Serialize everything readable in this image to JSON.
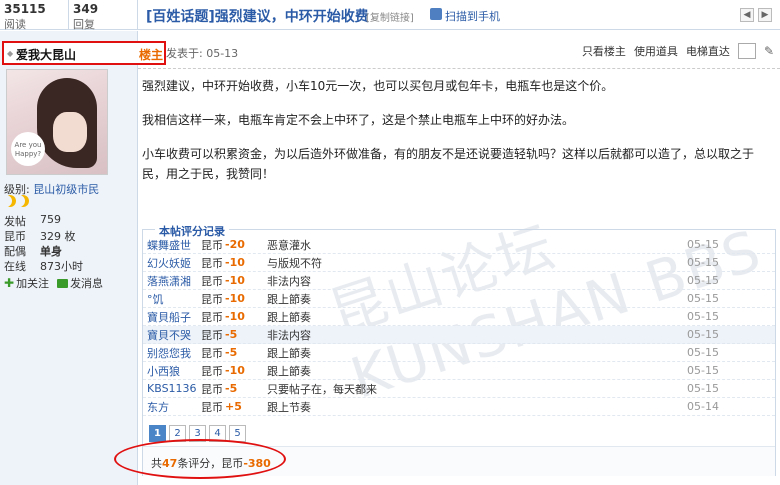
{
  "stats": [
    {
      "num": "35115",
      "label": "阅读"
    },
    {
      "num": "349",
      "label": "回复"
    }
  ],
  "thread": {
    "title": "[百姓话题]强烈建议，中环开始收费",
    "copy_link": "[复制链接]",
    "qr_text": "扫描到手机",
    "nav_prev": "◀",
    "nav_next": "▶"
  },
  "user": {
    "name": "爱我大昆山",
    "role": "楼主",
    "level_label": "级别:",
    "level_value": "昆山初级市民",
    "avatar_text": "Are you Happy?",
    "info": [
      {
        "k": "发帖",
        "v": "759"
      },
      {
        "k": "昆币",
        "v": "329 枚"
      },
      {
        "k": "配偶",
        "v": "单身"
      },
      {
        "k": "在线",
        "v": "873小时"
      }
    ],
    "follow_label": "加关注",
    "message_label": "发消息"
  },
  "post": {
    "date": "发表于: 05-13",
    "tools": [
      "只看楼主",
      "使用道具",
      "电梯直达"
    ],
    "paragraphs": [
      "强烈建议，中环开始收费，小车10元一次，也可以买包月或包年卡，电瓶车也是这个价。",
      "我相信这样一来，电瓶车肯定不会上中环了，这是个禁止电瓶车上中环的好办法。",
      "小车收费可以积累资金，为以后造外环做准备，有的朋友不是还说要造轻轨吗？这样以后就都可以造了，总以取之于民，用之于民，我赞同！"
    ]
  },
  "rating": {
    "title": "本帖评分记录",
    "rows": [
      {
        "user": "蝶舞盛世",
        "type": "昆币",
        "score": "-20",
        "reason": "恶意灌水",
        "date": "05-15"
      },
      {
        "user": "幻火妖姬",
        "type": "昆币",
        "score": "-10",
        "reason": "与版规不符",
        "date": "05-15"
      },
      {
        "user": "落燕潇湘",
        "type": "昆币",
        "score": "-10",
        "reason": "非法内容",
        "date": "05-15"
      },
      {
        "user": "°饥",
        "type": "昆币",
        "score": "-10",
        "reason": "跟上節奏",
        "date": "05-15"
      },
      {
        "user": "寶貝船子",
        "type": "昆币",
        "score": "-10",
        "reason": "跟上節奏",
        "date": "05-15"
      },
      {
        "user": "寶貝不哭",
        "type": "昆币",
        "score": "-5",
        "reason": "非法内容",
        "date": "05-15"
      },
      {
        "user": "别怨您我",
        "type": "昆币",
        "score": "-5",
        "reason": "跟上節奏",
        "date": "05-15"
      },
      {
        "user": "小西狼",
        "type": "昆币",
        "score": "-10",
        "reason": "跟上節奏",
        "date": "05-15"
      },
      {
        "user": "KBS1136",
        "type": "昆币",
        "score": "-5",
        "reason": "只要帖子在，每天都来",
        "date": "05-15"
      },
      {
        "user": "东方",
        "type": "昆币",
        "score": "+5",
        "reason": "跟上节奏",
        "date": "05-14"
      }
    ],
    "pages": [
      "1",
      "2",
      "3",
      "4",
      "5"
    ],
    "sum_prefix": "共",
    "sum_count": "47",
    "sum_mid": "条评分，昆币",
    "sum_total": "-380"
  },
  "watermark": "昆山论坛 KUNSHAN BBS"
}
